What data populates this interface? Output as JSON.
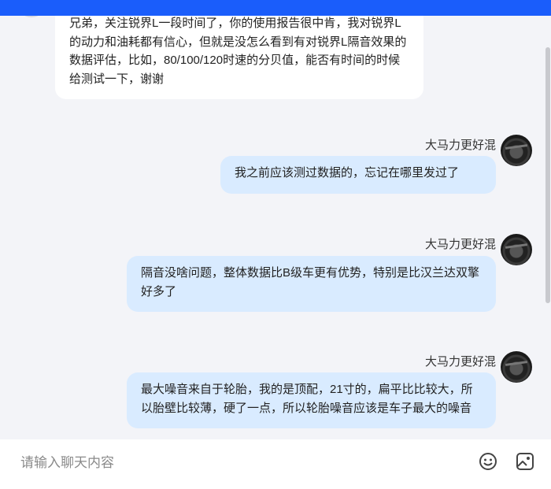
{
  "messages": [
    {
      "from": "other",
      "text": "兄弟，关注锐界L一段时间了，你的使用报告很中肯，我对锐界L的动力和油耗都有信心，但就是没怎么看到有对锐界L隔音效果的数据评估，比如，80/100/120时速的分贝值，能否有时间的时候给测试一下，谢谢"
    },
    {
      "from": "me",
      "name": "大马力更好混",
      "text": "我之前应该测过数据的，忘记在哪里发过了"
    },
    {
      "from": "me",
      "name": "大马力更好混",
      "text": "隔音没啥问题，整体数据比B级车更有优势，特别是比汉兰达双擎好多了"
    },
    {
      "from": "me",
      "name": "大马力更好混",
      "text": "最大噪音来自于轮胎，我的是顶配，21寸的，扁平比比较大，所以胎壁比较薄，硬了一点，所以轮胎噪音应该是车子最大的噪音"
    }
  ],
  "input": {
    "placeholder": "请输入聊天内容",
    "value": ""
  },
  "icons": {
    "emoji": "emoji-icon",
    "image": "image-icon"
  },
  "colors": {
    "accent": "#1a5dfb",
    "bubble_out": "#d9ebff",
    "bubble_in": "#ffffff"
  }
}
